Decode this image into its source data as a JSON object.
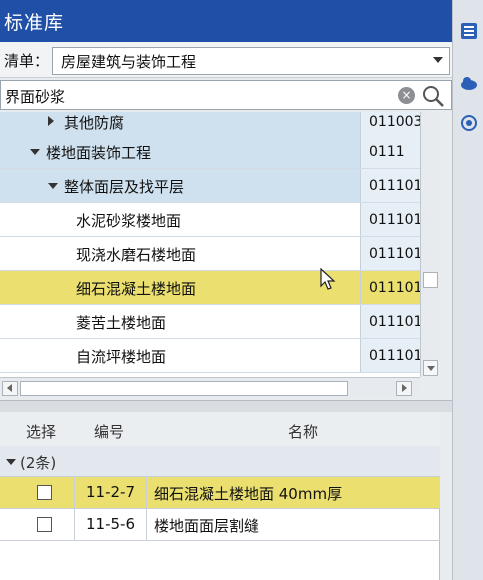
{
  "header": {
    "title": "标准库"
  },
  "list": {
    "label": "清单：",
    "selected": "房屋建筑与装饰工程"
  },
  "search": {
    "value": "界面砂浆",
    "clear_icon": "×"
  },
  "tree": {
    "rows": [
      {
        "name": "其他防腐",
        "code": "011003"
      },
      {
        "name": "楼地面装饰工程",
        "code": "0111"
      },
      {
        "name": "整体面层及找平层",
        "code": "011101"
      },
      {
        "name": "水泥砂浆楼地面",
        "code": "011101"
      },
      {
        "name": "现浇水磨石楼地面",
        "code": "011101"
      },
      {
        "name": "细石混凝土楼地面",
        "code": "011101"
      },
      {
        "name": "菱苦土楼地面",
        "code": "011101"
      },
      {
        "name": "自流坪楼地面",
        "code": "011101"
      }
    ]
  },
  "bottom_table": {
    "columns": {
      "select": "选择",
      "code": "编号",
      "name": "名称"
    },
    "group": "(2条)",
    "rows": [
      {
        "code": "11-2-7",
        "name": "细石混凝土楼地面 40mm厚"
      },
      {
        "code": "11-5-6",
        "name": "楼地面面层割缝"
      }
    ]
  },
  "colors": {
    "title_bar": "#1f4fa6",
    "selected_row": "#eadf6f",
    "tree_header_row": "#cfe1ef"
  },
  "icons": [
    "search-icon",
    "clear-icon",
    "dropdown-arrow-icon",
    "expand-triangle-icon",
    "checkbox-icon",
    "mouse-cursor-icon"
  ]
}
